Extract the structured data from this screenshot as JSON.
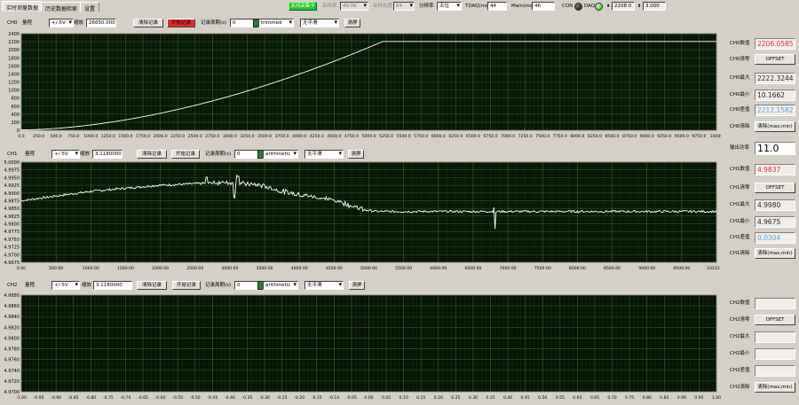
{
  "tabs": [
    "实时测量数据",
    "历史数据检索",
    "设置"
  ],
  "topbar": {
    "stop_button": "关闭采集卡",
    "sample_rate_label": "采样率",
    "sample_rate_value": "49.0K",
    "sample_len_label": "采样长度",
    "sample_len_value": "64",
    "resolution_label": "分辨率",
    "resolution_value": "五位",
    "tdaq_label": "TDAQ(ms)",
    "tdaq_value": "44",
    "main_label": "Main(ms)",
    "main_value": "46",
    "con_label": "CON",
    "daq_label": "DAQ",
    "readout_1": "2208.0",
    "readout_2": "3.000"
  },
  "colors": {
    "plot_bg": "#050e05",
    "grid": "#2f6b1f",
    "trace": "#ffffff",
    "value_red": "#e53030",
    "value_blue": "#5a9fd8"
  },
  "channels": [
    {
      "id": "CH0",
      "range_label": "量程",
      "range_value": "+/-5V",
      "scale_label": "缩放",
      "scale_value": "26650.00000",
      "clear_record": "清除记录",
      "start_record": "开始记录",
      "period_label": "记录周期(s)",
      "period_value": "0",
      "filter_value": "trimmed",
      "smooth_value": "无平滑",
      "clear_screen": "清屏",
      "stats": {
        "value_label": "CH0数值",
        "value": "2206.0585",
        "zero_label": "CH0清零",
        "zero_button": "OFFSET",
        "max_label": "CH0最大",
        "max": "2222.3244",
        "min_label": "CH0最小",
        "min": "10.1662",
        "diff_label": "CH0差值",
        "diff": "2212.1582",
        "clear_label": "CH0清除",
        "clear_button": "清除(max,min)"
      }
    },
    {
      "id": "CH1",
      "range_label": "量程",
      "range_value": "+/-5V",
      "scale_label": "缩放",
      "scale_value": "3.1180000",
      "clear_record": "清除记录",
      "start_record": "开始记录",
      "period_label": "记录周期(s)",
      "period_value": "0",
      "filter_value": "arithmetic",
      "smooth_value": "无平滑",
      "clear_screen": "清屏",
      "stats": {
        "value_label": "CH1数值",
        "value": "4.9837",
        "zero_label": "CH1清零",
        "zero_button": "OFFSET",
        "max_label": "CH1最大",
        "max": "4.9980",
        "min_label": "CH1最小",
        "min": "4.9675",
        "diff_label": "CH1差值",
        "diff": "0.0304",
        "clear_label": "CH1清除",
        "clear_button": "清除(max,min)"
      }
    },
    {
      "id": "CH2",
      "range_label": "量程",
      "range_value": "+/-5V",
      "scale_label": "缩放",
      "scale_value": "3.1180000",
      "clear_record": "清除记录",
      "start_record": "开始记录",
      "period_label": "记录周期(s)",
      "period_value": "0",
      "filter_value": "arithmetic",
      "smooth_value": "无平滑",
      "clear_screen": "清屏",
      "stats": {
        "value_label": "CH2数值",
        "value": "",
        "zero_label": "CH2清零",
        "zero_button": "OFFSET",
        "max_label": "CH2最大",
        "max": "",
        "min_label": "CH2最小",
        "min": "",
        "diff_label": "CH2差值",
        "diff": "",
        "clear_label": "CH2清除",
        "clear_button": "清除(max,min)"
      }
    }
  ],
  "output_power": {
    "label": "输出功率",
    "value": "11.0"
  },
  "chart_data": [
    {
      "type": "line",
      "title": "",
      "ylim": [
        0,
        2400
      ],
      "xlim": [
        0,
        10000
      ],
      "yticks": [
        "0",
        "200",
        "400",
        "600",
        "800",
        "1000",
        "1200",
        "1400",
        "1600",
        "1800",
        "2000",
        "2200",
        "2400"
      ],
      "xticks": [
        "0.0",
        "250.0",
        "500.0",
        "750.0",
        "1000.0",
        "1250.0",
        "1500.0",
        "1750.0",
        "2000.0",
        "2250.0",
        "2500.0",
        "2750.0",
        "3000.0",
        "3250.0",
        "3500.0",
        "3750.0",
        "4000.0",
        "4250.0",
        "4500.0",
        "4750.0",
        "5000.0",
        "5250.0",
        "5500.0",
        "5750.0",
        "6000.0",
        "6250.0",
        "6500.0",
        "6750.0",
        "7000.0",
        "7250.0",
        "7500.0",
        "7750.0",
        "8000.0",
        "8250.0",
        "8500.0",
        "8750.0",
        "9000.0",
        "9250.0",
        "9500.0",
        "9750.0",
        "10000"
      ],
      "series": [
        {
          "x": [
            0,
            1000,
            2000,
            3000,
            4000,
            4500,
            5000,
            5200,
            6000,
            8000,
            10000
          ],
          "y": [
            10,
            120,
            420,
            880,
            1400,
            1700,
            2020,
            2206,
            2206,
            2206,
            2206
          ]
        }
      ]
    },
    {
      "type": "line",
      "title": "",
      "ylim": [
        4.9675,
        5.0
      ],
      "xlim": [
        0,
        10131
      ],
      "yticks": [
        "4.9675",
        "4.9700",
        "4.9725",
        "4.9750",
        "4.9775",
        "4.9800",
        "4.9825",
        "4.9850",
        "4.9875",
        "4.9900",
        "4.9925",
        "4.9950",
        "4.9975",
        "5.0000"
      ],
      "xticks": [
        "0.00",
        "500.00",
        "1000.00",
        "1500.00",
        "2000.00",
        "2500.00",
        "3000.00",
        "3500.00",
        "4000.00",
        "4500.00",
        "5000.00",
        "5500.00",
        "6000.00",
        "6500.00",
        "7000.00",
        "7500.00",
        "8000.00",
        "8500.00",
        "9000.00",
        "9500.00",
        "10131.00"
      ],
      "series": [
        {
          "x": [
            0,
            500,
            1000,
            1500,
            2000,
            2500,
            3000,
            3500,
            3800,
            4200,
            4600,
            5000,
            5200,
            6000,
            7000,
            8000,
            9000,
            10131
          ],
          "y": [
            4.9875,
            4.989,
            4.9905,
            4.9915,
            4.9925,
            4.993,
            4.9935,
            4.9925,
            4.9905,
            4.989,
            4.9875,
            4.9845,
            4.984,
            4.984,
            4.984,
            4.984,
            4.984,
            4.984
          ]
        }
      ]
    },
    {
      "type": "line",
      "title": "",
      "ylim": [
        4.97,
        4.988
      ],
      "xlim": [
        -1,
        1
      ],
      "yticks": [
        "4.9700",
        "4.9720",
        "4.9740",
        "4.9760",
        "4.9780",
        "4.9800",
        "4.9820",
        "4.9840",
        "4.9860",
        "4.9880"
      ],
      "xticks": [
        "-1.00",
        "-0.95",
        "-0.90",
        "-0.85",
        "-0.80",
        "-0.75",
        "-0.70",
        "-0.65",
        "-0.60",
        "-0.55",
        "-0.50",
        "-0.45",
        "-0.40",
        "-0.35",
        "-0.30",
        "-0.25",
        "-0.20",
        "-0.15",
        "-0.10",
        "-0.05",
        "0.00",
        "0.05",
        "0.10",
        "0.15",
        "0.20",
        "0.25",
        "0.30",
        "0.35",
        "0.40",
        "0.45",
        "0.50",
        "0.55",
        "0.60",
        "0.65",
        "0.70",
        "0.75",
        "0.80",
        "0.85",
        "0.90",
        "0.95",
        "1.00"
      ],
      "series": [
        {
          "x": [],
          "y": []
        }
      ]
    }
  ]
}
